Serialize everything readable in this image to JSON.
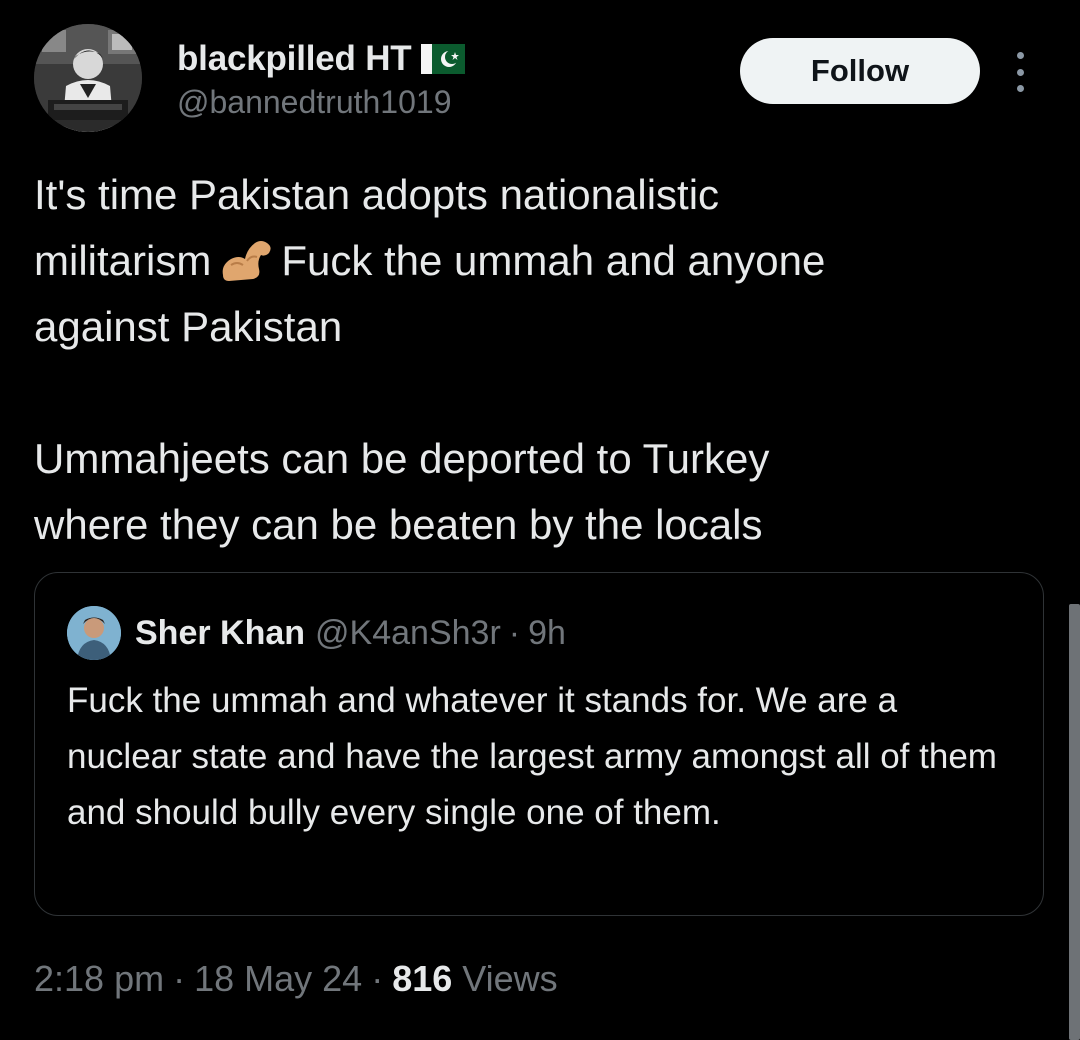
{
  "author": {
    "display_name": "blackpilled HT",
    "flag_icon": "pakistan-flag-icon",
    "handle": "@bannedtruth1019",
    "avatar_icon": "vintage-man-at-typewriter-avatar"
  },
  "actions": {
    "follow_label": "Follow",
    "more_icon": "vertical-ellipsis-icon"
  },
  "tweet": {
    "line_1": "It's time Pakistan adopts nationalistic",
    "line_2_before_emoji": "militarism",
    "emoji_icon": "flexed-biceps-emoji",
    "line_2_after_emoji": "Fuck the ummah and anyone",
    "line_3": "against Pakistan",
    "line_4": "Ummahjeets can be deported to Turkey",
    "line_5": "where they can be beaten by the locals"
  },
  "quoted": {
    "display_name": "Sher Khan",
    "handle": "@K4anSh3r",
    "separator": "·",
    "time": "9h",
    "avatar_icon": "young-man-avatar",
    "text": "Fuck the ummah and whatever it stands for. We are a nuclear state and have the largest army amongst all of them and should bully every single one of them."
  },
  "meta": {
    "time": "2:18 pm",
    "separator": "·",
    "date": "18 May 24",
    "views_count": "816",
    "views_label": "Views"
  },
  "colors": {
    "background": "#000000",
    "text_primary": "#e7e9ea",
    "text_secondary": "#71767b",
    "border": "#2f3336",
    "follow_bg": "#eff3f4"
  }
}
